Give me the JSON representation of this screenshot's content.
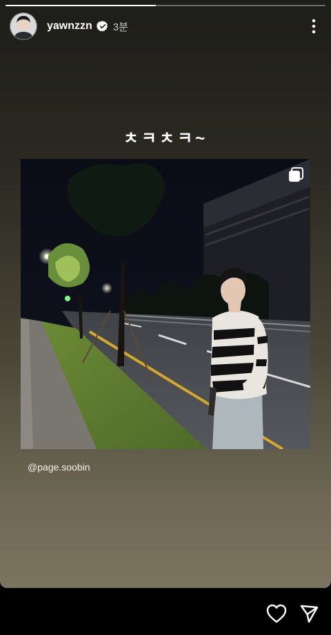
{
  "story": {
    "progress": 0.47,
    "username": "yawnzzn",
    "verified": true,
    "time_ago": "3분",
    "caption": "ㅊㅋㅊㅋ~",
    "mention": "@page.soobin"
  },
  "icons": {
    "verified": "verified-badge-icon",
    "more": "more-vertical-icon",
    "multi": "multiple-photos-icon",
    "like": "heart-icon",
    "share": "send-icon"
  }
}
